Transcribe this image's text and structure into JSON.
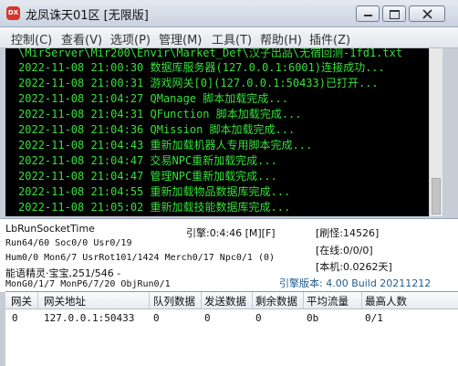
{
  "window": {
    "title": "龙凤诛天01区 [无限版]",
    "icon_text": "DX"
  },
  "menu": [
    "控制(C)",
    "查看(V)",
    "选项(P)",
    "管理(M)",
    "工具(T)",
    "帮助(H)",
    "插件(Z)"
  ],
  "log": [
    "\\MirServer\\Mir200\\Envir\\Market_Def\\汉子出品\\无宿回测-1fd1.txt",
    "2022-11-08 21:00:30 数据库服务器(127.0.0.1:6001)连接成功...",
    "2022-11-08 21:00:31 游戏网关[0](127.0.0.1:50433)已打开...",
    "2022-11-08 21:04:27 QManage 脚本加载完成...",
    "2022-11-08 21:04:31 QFunction 脚本加载完成...",
    "2022-11-08 21:04:36 QMission 脚本加载完成...",
    "2022-11-08 21:04:43 重新加载机器人专用脚本完成...",
    "2022-11-08 21:04:47 交易NPC重新加载完成...",
    "2022-11-08 21:04:47 管理NPC重新加载完成...",
    "2022-11-08 21:04:55 重新加载物品数据库完成...",
    "2022-11-08 21:05:02 重新加载技能数据库完成..."
  ],
  "status": {
    "socket_label": "LbRunSocketTime",
    "engine_time": "引擎:0:4:46 [M][F]",
    "refresh": "[刷怪:14526]",
    "run_line": "Run64/60 Soc0/0 Usr0/19",
    "online": "[在线:0/0/0]",
    "hum_line": "Hum0/0 Mon6/7 UsrRot101/1424 Merch0/17 Npc0/1 (0)",
    "local": "[本机:0.0262天]",
    "genie_line": "能语精灵·宝宝,251/546 -",
    "mon_line": "MonG0/1/7 MonP6/7/20 ObjRun0/1",
    "version": "引擎版本: 4.00 Build 20211212"
  },
  "table": {
    "headers": [
      "网关",
      "网关地址",
      "队列数据",
      "发送数据",
      "剩余数据",
      "平均流量",
      "最高人数"
    ],
    "rows": [
      [
        "0",
        "127.0.0.1:50433",
        "0",
        "0",
        "0",
        "0b",
        "0/1"
      ]
    ]
  },
  "colors": {
    "log_text": "#36e03a",
    "log_background": "#000000",
    "version_text": "#1f5c8f",
    "icon_red": "#d4372b"
  }
}
